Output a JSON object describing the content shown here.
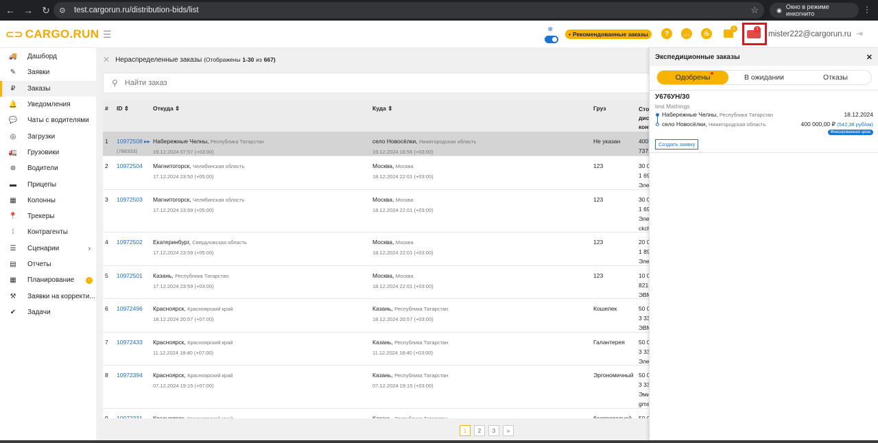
{
  "browser": {
    "url": "test.cargorun.ru/distribution-bids/list",
    "incognito": "Окно в режиме инкогнито"
  },
  "header": {
    "logo": "CARGO.RUN",
    "recommended": "Рекомендованные заказы",
    "badge_docs": "1",
    "badge_trucks": "1",
    "user_email": "mister222@cargorun.ru"
  },
  "sidebar": {
    "items": [
      {
        "label": "Дашборд",
        "icon": "🚚"
      },
      {
        "label": "Заявки",
        "icon": "✎"
      },
      {
        "label": "Заказы",
        "icon": "₽",
        "active": true
      },
      {
        "label": "Уведомления",
        "icon": "🔔"
      },
      {
        "label": "Чаты с водителями",
        "icon": "💬"
      },
      {
        "label": "Загрузки",
        "icon": "◎"
      },
      {
        "label": "Грузовики",
        "icon": "🚛"
      },
      {
        "label": "Водители",
        "icon": "⊛"
      },
      {
        "label": "Прицепы",
        "icon": "▬"
      },
      {
        "label": "Колонны",
        "icon": "▦"
      },
      {
        "label": "Трекеры",
        "icon": "📍"
      },
      {
        "label": "Контрагенты",
        "icon": "⁞"
      },
      {
        "label": "Сценарии",
        "icon": "☰"
      },
      {
        "label": "Отчеты",
        "icon": "▤"
      },
      {
        "label": "Планирование",
        "icon": "▦"
      },
      {
        "label": "Заявки на корректи...",
        "icon": "⚒"
      },
      {
        "label": "Задачи",
        "icon": "✔"
      }
    ]
  },
  "main": {
    "title_prefix": "Нераспределенные заказы",
    "title_shown": "(Отображены",
    "title_range": "1-30",
    "title_of": "из",
    "title_total": "667)",
    "search_placeholder": "Найти заказ",
    "columns": {
      "num": "#",
      "id": "ID ⇕",
      "from": "Откуда ⇕",
      "to": "Куда ⇕",
      "cargo": "Груз",
      "price": "Сто\nдист\nконт"
    },
    "rows": [
      {
        "n": "1",
        "id": "10972508 ▸▸",
        "id2": "(788333)",
        "from_city": "Набережные Челны,",
        "from_reg": "Республика Татарстан",
        "from_dt": "19.12.2024 07:57 (+03:00)",
        "to_city": "село Новосёлки,",
        "to_reg": "Нижегородская область",
        "to_dt": "19.12.2024 16:56 (+03:00)",
        "cargo": "Не указан",
        "p1": "400",
        "p2": "737,",
        "p3": ""
      },
      {
        "n": "2",
        "id": "10972504",
        "id2": "",
        "from_city": "Магнитогорск,",
        "from_reg": "Челябинская область",
        "from_dt": "17.12.2024 23:50 (+05:00)",
        "to_city": "Москва,",
        "to_reg": "Москва",
        "to_dt": "18.12.2024 22:01 (+03:00)",
        "cargo": "123",
        "p1": "30 0",
        "p2": "1 69",
        "p3": "Элек"
      },
      {
        "n": "3",
        "id": "10972503",
        "id2": "",
        "from_city": "Магнитогорск,",
        "from_reg": "Челябинская область",
        "from_dt": "17.12.2024 23:59 (+05:00)",
        "to_city": "Москва,",
        "to_reg": "Москва",
        "to_dt": "18.12.2024 22:01 (+03:00)",
        "cargo": "123",
        "p1": "30 0",
        "p2": "1 69",
        "p3": "Элек",
        "p4": "ckch"
      },
      {
        "n": "4",
        "id": "10972502",
        "id2": "",
        "from_city": "Екатеринбург,",
        "from_reg": "Свердловская область",
        "from_dt": "17.12.2024 23:59 (+05:00)",
        "to_city": "Москва,",
        "to_reg": "Москва",
        "to_dt": "18.12.2024 22:01 (+03:00)",
        "cargo": "123",
        "p1": "20 0",
        "p2": "1 89",
        "p3": "Элек"
      },
      {
        "n": "5",
        "id": "10972501",
        "id2": "",
        "from_city": "Казань,",
        "from_reg": "Республика Татарстан",
        "from_dt": "17.12.2024 23:59 (+03:00)",
        "to_city": "Москва,",
        "to_reg": "Москва",
        "to_dt": "18.12.2024 22:01 (+03:00)",
        "cargo": "123",
        "p1": "10 0",
        "p2": "821,",
        "p3": "ЭВМ"
      },
      {
        "n": "6",
        "id": "10972496",
        "id2": "",
        "from_city": "Красноярск,",
        "from_reg": "Красноярский край",
        "from_dt": "18.12.2024 20:57 (+07:00)",
        "to_city": "Казань,",
        "to_reg": "Республика Татарстан",
        "to_dt": "18.12.2024 20:57 (+03:00)",
        "cargo": "Кошелек",
        "p1": "50 0",
        "p2": "3 33",
        "p3": "ЭВМ"
      },
      {
        "n": "7",
        "id": "10972433",
        "id2": "",
        "from_city": "Красноярск,",
        "from_reg": "Красноярский край",
        "from_dt": "11.12.2024 18:40 (+07:00)",
        "to_city": "Казань,",
        "to_reg": "Республика Татарстан",
        "to_dt": "11.12.2024 18:40 (+03:00)",
        "cargo": "Галантерея",
        "p1": "50 0",
        "p2": "3 33",
        "p3": "Элек"
      },
      {
        "n": "8",
        "id": "10972394",
        "id2": "",
        "from_city": "Красноярск,",
        "from_reg": "Красноярский край",
        "from_dt": "07.12.2024 19:15 (+07:00)",
        "to_city": "Казань,",
        "to_reg": "Республика Татарстан",
        "to_dt": "07.12.2024 19:15 (+03:00)",
        "cargo": "Эргономичный",
        "p1": "50 0",
        "p2": "3 33",
        "p3": "Эми",
        "p4": "gms"
      },
      {
        "n": "9",
        "id": "10972331",
        "id2": "",
        "from_city": "Красноярск,",
        "from_reg": "Красноярский край",
        "from_dt": "",
        "to_city": "Казань,",
        "to_reg": "Республика Татарстан",
        "to_dt": "",
        "cargo": "беспроводной",
        "p1": "50 0",
        "p2": "",
        "p3": ""
      }
    ],
    "pager": [
      "1",
      "2",
      "3",
      "»"
    ]
  },
  "panel": {
    "title": "Экспедиционные заказы",
    "tabs": [
      "Одобрены",
      "В ожидании",
      "Отказы"
    ],
    "card": {
      "number": "У676УН/30",
      "company": "test Mathings",
      "from_city": "Набережные Челны,",
      "from_reg": "Республика Татарстан",
      "to_city": "село Новосёлки,",
      "to_reg": "Нижегородская область",
      "date": "18.12.2024",
      "price": "400 000,00 ₽",
      "price_km": "(542,38 руб/км)",
      "fixed": "Фиксированная цена",
      "create": "Создать заявку"
    }
  }
}
